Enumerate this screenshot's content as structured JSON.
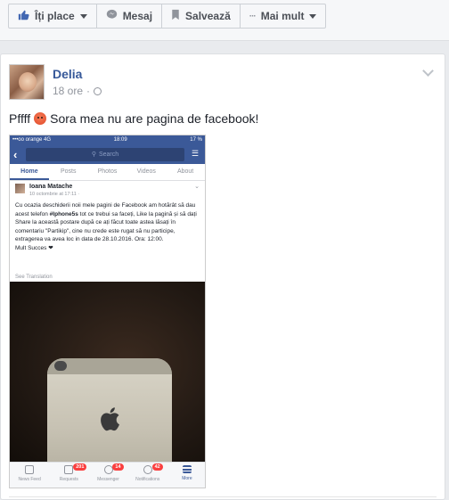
{
  "toolbar": {
    "like_label": "Îți place",
    "message_label": "Mesaj",
    "save_label": "Salvează",
    "more_label": "Mai mult"
  },
  "post": {
    "author": "Delia",
    "time": "18 ore",
    "text": "Pffff",
    "text_after_emoji": "Sora mea nu are pagina de facebook!"
  },
  "screenshot": {
    "status_carrier": "•••oo orange  4G",
    "status_time": "18:09",
    "status_battery": "17 %",
    "search_placeholder": "Search",
    "tabs": [
      "Home",
      "Posts",
      "Photos",
      "Videos",
      "About"
    ],
    "inner_author": "Ioana Matache",
    "inner_date": "10 octombrie at 17:11 ·",
    "inner_text_1": "Cu ocazia deschiderii noii mele pagini de Facebook am hotărât să dau acest telefon ",
    "inner_hashtag": "#Iphone5s",
    "inner_text_2": " tot ce trebui sa faceți, Like la pagină  și să dați Share la  această postare după ce ați făcut toate astea lăsați în comentariu \"Partikip\", cine nu crede este rugat să nu participe, extragerea va avea loc in data de 28.10.2016.   Ora: 12:00.",
    "inner_signoff": "Mult Succes ❤",
    "see_translation": "See Translation",
    "nav": [
      {
        "label": "News Feed",
        "badge": ""
      },
      {
        "label": "Requests",
        "badge": "201"
      },
      {
        "label": "Messenger",
        "badge": "14"
      },
      {
        "label": "Notifications",
        "badge": "42"
      },
      {
        "label": "More",
        "badge": ""
      }
    ]
  },
  "colors": {
    "link": "#365899",
    "fb_blue": "#3b5998",
    "badge_red": "#fa3e3e"
  }
}
